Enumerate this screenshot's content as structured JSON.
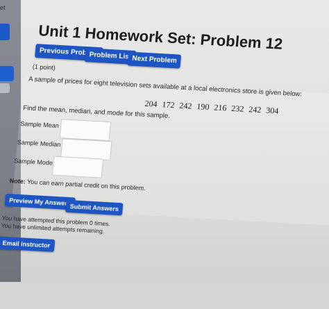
{
  "sidebar": {
    "label": "et"
  },
  "header": {
    "title": "Unit 1 Homework Set: Problem 12"
  },
  "nav": {
    "previous_label": "Previous Problem",
    "list_label": "Problem List",
    "next_label": "Next Problem"
  },
  "problem": {
    "points": "(1 point)",
    "statement": "A sample of prices for eight television sets available at a local electronics store is given below:",
    "prices": "204  172  242  190  216  232  242  304",
    "instruction": "Find the mean, median, and mode for this sample.",
    "fields": {
      "mean_label": "Sample Mean =",
      "median_label": "Sample Median =",
      "mode_label": "Sample Mode ="
    }
  },
  "footer": {
    "note_bold": "Note:",
    "note_text": " You can earn partial credit on this problem.",
    "preview_label": "Preview My Answers",
    "submit_label": "Submit Answers",
    "attempts_line1": "You have attempted this problem 0 times.",
    "attempts_line2": "You have unlimited attempts remaining.",
    "email_label": "Email instructor"
  }
}
